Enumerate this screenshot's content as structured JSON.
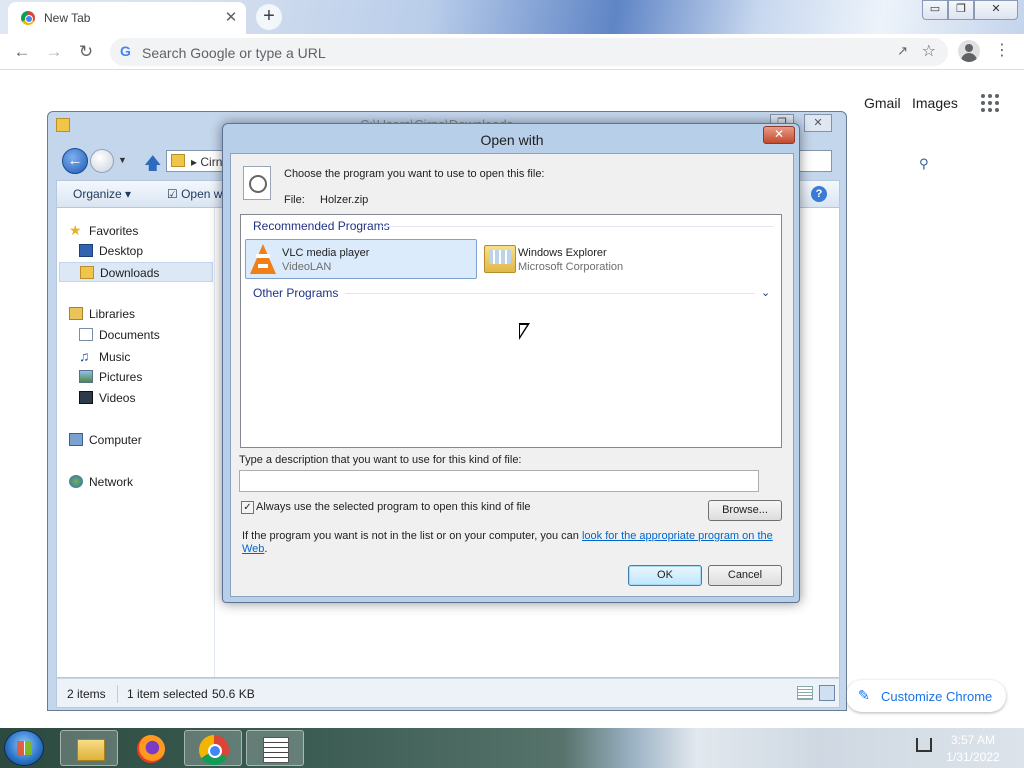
{
  "chrome": {
    "tab_title": "New Tab",
    "tab_close": "✕",
    "new_tab": "+",
    "omnibox_placeholder": "Search Google or type a URL",
    "google_g": "G",
    "links": {
      "gmail": "Gmail",
      "images": "Images"
    },
    "customize_label": "Customize Chrome",
    "window_controls": {
      "minimize": "▭",
      "maximize": "❐",
      "close": "✕"
    }
  },
  "explorer": {
    "title": "C:\\Users\\Cirno\\Downloads",
    "address_crumb": "Cirno",
    "toolbar": {
      "organize": "Organize ▾",
      "open_with": "Open with"
    },
    "nav": {
      "favorites": "Favorites",
      "desktop": "Desktop",
      "downloads": "Downloads",
      "libraries": "Libraries",
      "documents": "Documents",
      "music": "Music",
      "pictures": "Pictures",
      "videos": "Videos",
      "computer": "Computer",
      "network": "Network"
    },
    "status": {
      "items": "2 items",
      "selected": "1 item selected",
      "size": "50.6 KB"
    }
  },
  "dialog": {
    "title": "Open with",
    "choose_text": "Choose the program you want to use to open this file:",
    "file_label": "File:",
    "file_name": "Holzer.zip",
    "recommended_header": "Recommended Programs",
    "other_header": "Other Programs",
    "programs": [
      {
        "name": "VLC media player",
        "vendor": "VideoLAN",
        "selected": true
      },
      {
        "name": "Windows Explorer",
        "vendor": "Microsoft Corporation",
        "selected": false
      }
    ],
    "description_label": "Type a description that you want to use for this kind of file:",
    "description_value": "",
    "always_use_label": "Always use the selected program to open this kind of file",
    "always_use_checked": true,
    "browse_label": "Browse...",
    "hint_prefix": "If the program you want is not in the list or on your computer, you can ",
    "hint_link": "look for the appropriate program on the Web",
    "hint_suffix": ".",
    "ok_label": "OK",
    "cancel_label": "Cancel"
  },
  "taskbar": {
    "time": "3:57 AM",
    "date": "1/31/2022"
  },
  "colors": {
    "dialog_frame": "#b8cfea",
    "link_blue": "#0066cc",
    "group_header": "#1e3287",
    "selection": "#dcebfc"
  }
}
